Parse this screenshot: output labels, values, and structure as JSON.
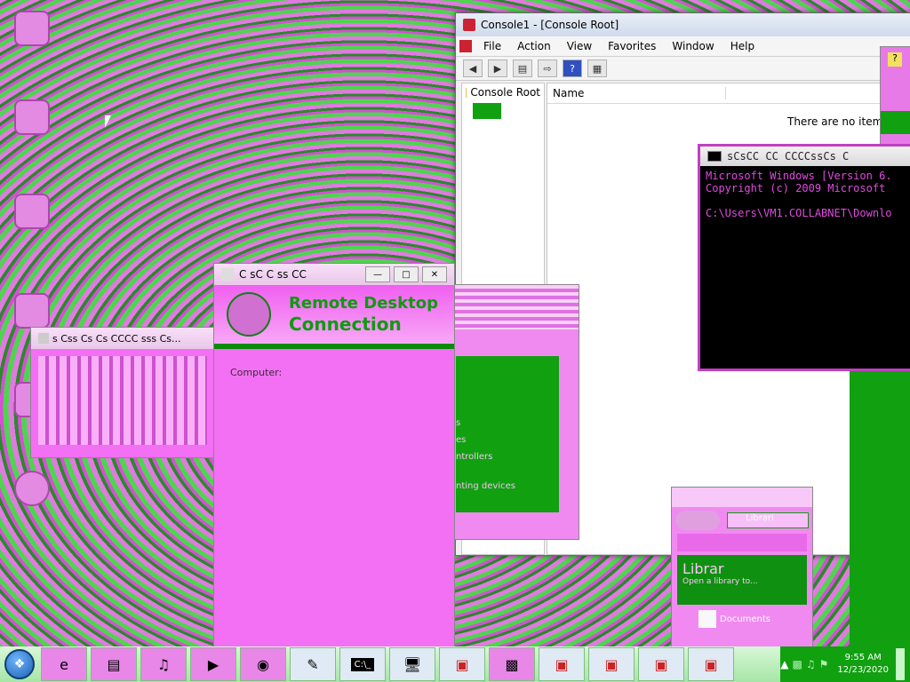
{
  "desktop_icons": [
    {
      "label": "",
      "icon": "recycle-bin-icon"
    },
    {
      "label": "",
      "icon": "computer-icon"
    },
    {
      "label": "",
      "icon": "network-icon"
    },
    {
      "label": "",
      "icon": "folder-icon"
    },
    {
      "label": "",
      "icon": "document-icon"
    },
    {
      "label": "",
      "icon": "settings-icon"
    }
  ],
  "mmc": {
    "title": "Console1 - [Console Root]",
    "menu": [
      "File",
      "Action",
      "View",
      "Favorites",
      "Window",
      "Help"
    ],
    "tree_root": "Console Root",
    "list_header_name": "Name",
    "empty_message": "There are no items t"
  },
  "cmd": {
    "title": "sCsCC  CC CCCCssCs C",
    "lines": [
      "Microsoft Windows [Version 6.",
      "Copyright (c) 2009 Microsoft",
      "",
      "C:\\Users\\VM1.COLLABNET\\Downlo"
    ]
  },
  "rdc": {
    "title": "C  sC C ss CC",
    "banner_line1": "Remote Desktop",
    "banner_line2": "Connection",
    "computer_label": "Computer:"
  },
  "small_window": {
    "title": "s Css     Cs Cs    CCCC    sss     Cs..."
  },
  "device_window": {
    "items": [
      "s",
      "es",
      "ntrollers",
      "nting devices"
    ]
  },
  "libraries_window": {
    "address": "Librari",
    "heading": "Librar",
    "subtext": "Open a library to...",
    "doc_label": "Documents"
  },
  "taskbar": {
    "clock_time": "9:55 AM",
    "clock_date": "12/23/2020",
    "items": [
      "ie-icon",
      "explorer-icon",
      "media-icon",
      "player-icon",
      "disc-icon",
      "notepad-icon",
      "cmd-icon",
      "remote-desktop-icon",
      "toolbox-icon",
      "window-icon",
      "toolbox-icon",
      "toolbox-icon",
      "toolbox-icon",
      "toolbox-icon"
    ]
  },
  "colors": {
    "accent_magenta": "#e06be0",
    "accent_green": "#1aa51a",
    "taskbar": "#bff0bf"
  }
}
